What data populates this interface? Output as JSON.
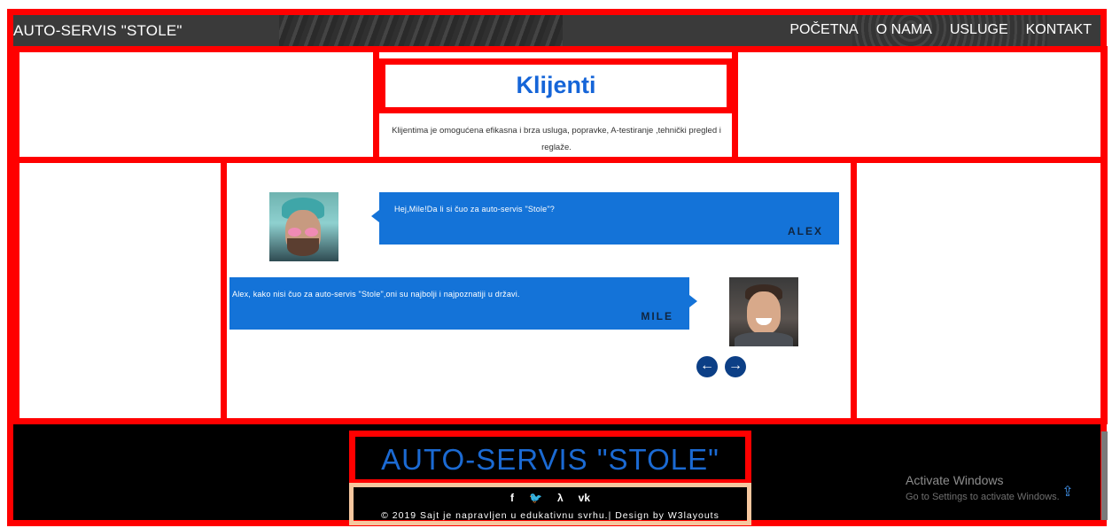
{
  "navbar": {
    "brand": "AUTO-SERVIS \"STOLE\"",
    "links": [
      "POČETNA",
      "O NAMA",
      "USLUGE",
      "KONTAKT"
    ]
  },
  "header": {
    "title": "Klijenti",
    "description": "Klijentima je omogućena efikasna i brza usluga, popravke, A-testiranje ,tehnički pregled i reglaže."
  },
  "testimonials": [
    {
      "message": "Hej,Mile!Da li si čuo za auto-servis \"Stole\"?",
      "author": "ALEX"
    },
    {
      "message": "Alex, kako nisi čuo za auto-servis \"Stole\",oni su najbolji i najpoznatiji u državi.",
      "author": "MILE"
    }
  ],
  "carousel": {
    "prev_icon": "arrow-left-icon",
    "next_icon": "arrow-right-icon",
    "prev_glyph": "←",
    "next_glyph": "→"
  },
  "footer": {
    "title": "AUTO-SERVIS \"STOLE\"",
    "social": [
      {
        "icon": "facebook-icon",
        "glyph": "f"
      },
      {
        "icon": "twitter-icon",
        "glyph": "🐦"
      },
      {
        "icon": "rss-icon",
        "glyph": "λ"
      },
      {
        "icon": "vk-icon",
        "glyph": "vk"
      }
    ],
    "copyright": "© 2019 Sajt je napravljen u edukativnu svrhu.| Design by W3layouts"
  },
  "windows_watermark": {
    "title": "Activate Windows",
    "subtitle": "Go to Settings to activate Windows."
  },
  "colors": {
    "annotation_red": "#ff0000",
    "annotation_peach": "#f6c79f",
    "accent_blue": "#1473d8",
    "title_blue": "#1565d8",
    "nav_dark": "#3a3a3a"
  }
}
